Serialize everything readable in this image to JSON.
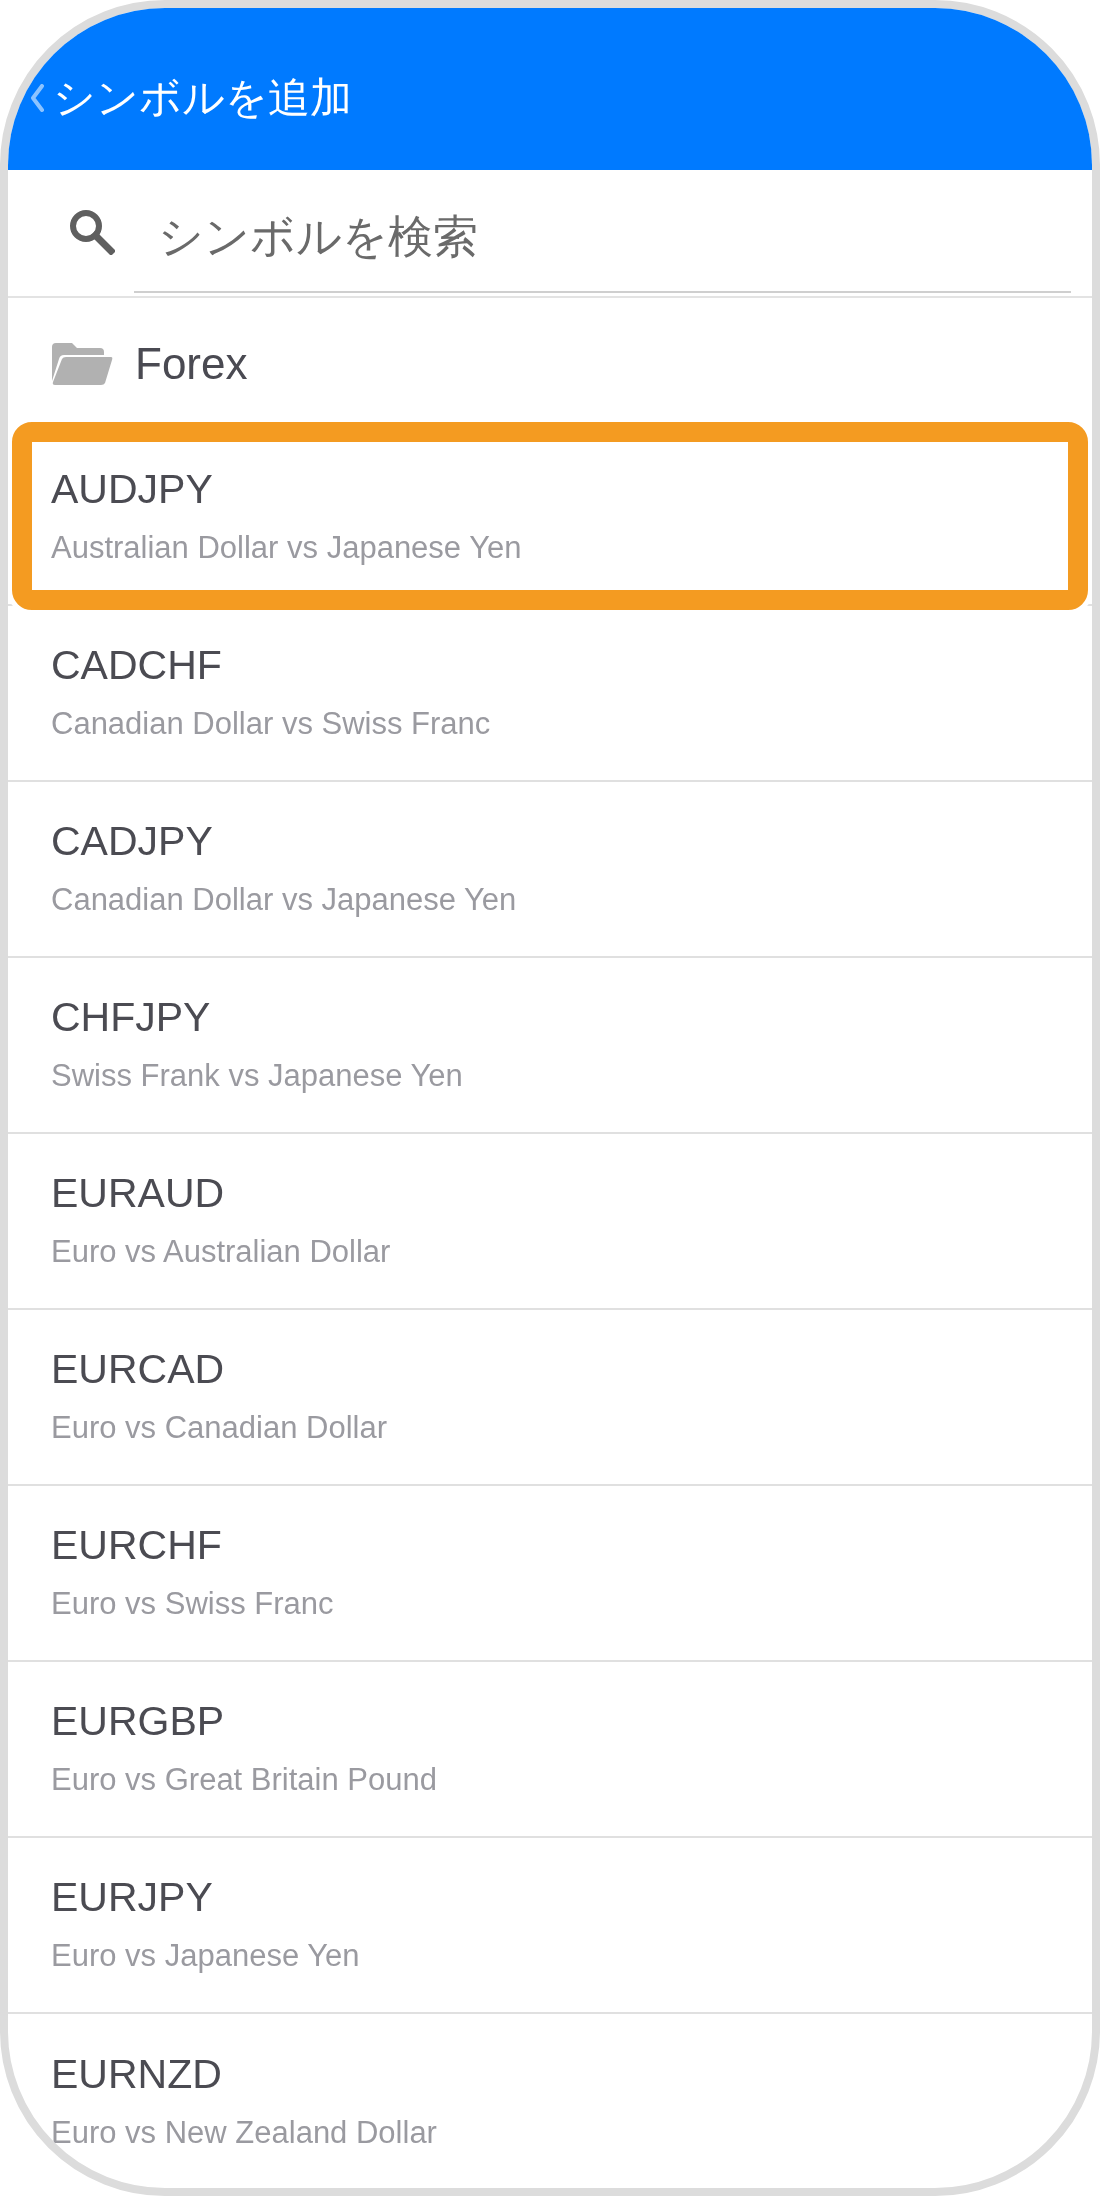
{
  "header": {
    "title": "シンボルを追加"
  },
  "search": {
    "placeholder": "シンボルを検索"
  },
  "group": {
    "name": "Forex"
  },
  "symbols": [
    {
      "symbol": "AUDJPY",
      "description": "Australian Dollar vs Japanese Yen",
      "highlighted": true
    },
    {
      "symbol": "CADCHF",
      "description": "Canadian Dollar vs Swiss Franc",
      "highlighted": false
    },
    {
      "symbol": "CADJPY",
      "description": "Canadian Dollar vs Japanese Yen",
      "highlighted": false
    },
    {
      "symbol": "CHFJPY",
      "description": "Swiss Frank vs Japanese Yen",
      "highlighted": false
    },
    {
      "symbol": "EURAUD",
      "description": "Euro vs Australian Dollar",
      "highlighted": false
    },
    {
      "symbol": "EURCAD",
      "description": "Euro vs Canadian Dollar",
      "highlighted": false
    },
    {
      "symbol": "EURCHF",
      "description": "Euro vs Swiss Franc",
      "highlighted": false
    },
    {
      "symbol": "EURGBP",
      "description": "Euro vs Great Britain Pound",
      "highlighted": false
    },
    {
      "symbol": "EURJPY",
      "description": "Euro vs Japanese Yen",
      "highlighted": false
    },
    {
      "symbol": "EURNZD",
      "description": "Euro vs New Zealand Dollar",
      "highlighted": false
    }
  ]
}
